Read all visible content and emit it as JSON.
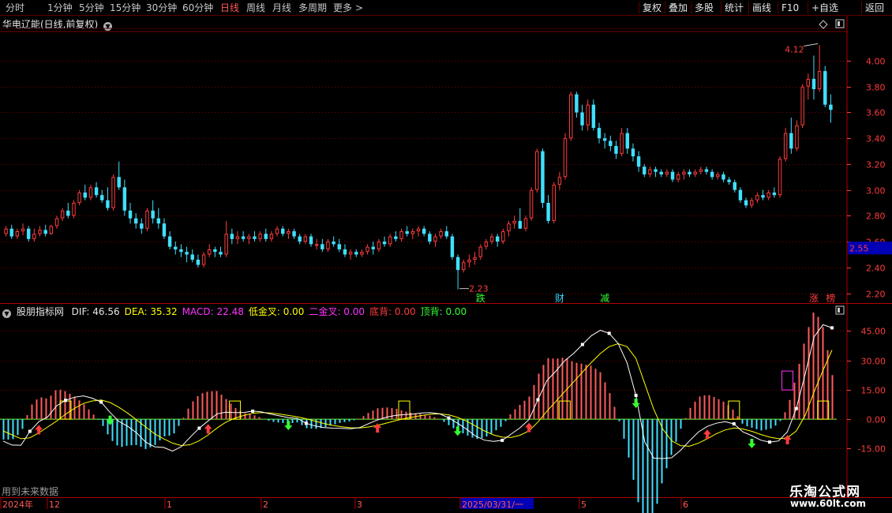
{
  "toolbar": {
    "periods": [
      "分时",
      "1分钟",
      "5分钟",
      "15分钟",
      "30分钟",
      "60分钟",
      "日线",
      "周线",
      "月线",
      "多周期",
      "更多"
    ],
    "active_period": "日线",
    "more_arrow": ">",
    "buttons": [
      "复权",
      "叠加",
      "多股",
      "统计",
      "画线",
      "F10",
      "+自选",
      "返回"
    ]
  },
  "main_chart": {
    "title": "华电辽能(日线,前复权)",
    "price_label": "2.55",
    "high_label": "4.12",
    "low_label": "2.23",
    "event_markers": [
      {
        "label": "跌",
        "color": "#33ff33"
      },
      {
        "label": "财",
        "color": "#33d6ff"
      },
      {
        "label": "减",
        "color": "#33ff33"
      },
      {
        "label": "涨",
        "color": "#ff3c3c"
      },
      {
        "label": "榜",
        "color": "#ff3c3c"
      }
    ]
  },
  "indicator": {
    "name": "股朋指标网",
    "items": [
      {
        "text": "DIF: 46.56",
        "color": "#e6e6e6"
      },
      {
        "text": "DEA: 35.32",
        "color": "#ffff00"
      },
      {
        "text": "MACD: 22.48",
        "color": "#ff33ff"
      },
      {
        "text": "低金叉: 0.00",
        "color": "#ffff00"
      },
      {
        "text": "二金叉: 0.00",
        "color": "#ff33ff"
      },
      {
        "text": "底背: 0.00",
        "color": "#ff3c3c"
      },
      {
        "text": "顶背: 0.00",
        "color": "#33ff33"
      }
    ]
  },
  "footer": {
    "note": "用到未来数据",
    "watermark_cn": "乐淘公式网",
    "watermark_url": "www.60lt.com",
    "date_labels": [
      "2024年",
      "12",
      "1",
      "2",
      "3",
      "2025/03/31/一",
      "5",
      "6"
    ]
  },
  "colors": {
    "up": "#ff3c3c",
    "down": "#40e0ff",
    "dif": "#ffffff",
    "dea": "#ffff00",
    "grid": "#7a0000",
    "axis": "#ff3c3c"
  },
  "chart_data": [
    {
      "type": "candlestick",
      "title": "华电辽能(日线,前复权)",
      "y_ticks": [
        2.2,
        2.4,
        2.6,
        2.8,
        3.0,
        3.2,
        3.4,
        3.6,
        3.8,
        4.0
      ],
      "ylim": [
        2.13,
        4.22
      ],
      "last_price": 2.55,
      "highest": 4.12,
      "lowest": 2.23,
      "grid": true,
      "candles": [
        [
          2.66,
          2.72,
          2.64,
          2.7
        ],
        [
          2.7,
          2.73,
          2.62,
          2.64
        ],
        [
          2.64,
          2.7,
          2.62,
          2.68
        ],
        [
          2.68,
          2.74,
          2.65,
          2.7
        ],
        [
          2.7,
          2.72,
          2.6,
          2.62
        ],
        [
          2.62,
          2.7,
          2.6,
          2.66
        ],
        [
          2.66,
          2.72,
          2.64,
          2.69
        ],
        [
          2.69,
          2.73,
          2.64,
          2.66
        ],
        [
          2.66,
          2.73,
          2.65,
          2.72
        ],
        [
          2.72,
          2.8,
          2.7,
          2.78
        ],
        [
          2.78,
          2.86,
          2.76,
          2.84
        ],
        [
          2.84,
          2.9,
          2.78,
          2.8
        ],
        [
          2.8,
          2.92,
          2.78,
          2.9
        ],
        [
          2.9,
          3.0,
          2.88,
          2.98
        ],
        [
          2.98,
          3.04,
          2.92,
          2.94
        ],
        [
          2.94,
          3.04,
          2.92,
          3.02
        ],
        [
          3.02,
          3.06,
          2.94,
          2.96
        ],
        [
          2.96,
          3.0,
          2.9,
          2.92
        ],
        [
          2.92,
          3.02,
          2.84,
          2.86
        ],
        [
          2.86,
          3.12,
          2.84,
          3.1
        ],
        [
          3.1,
          3.22,
          3.0,
          3.02
        ],
        [
          3.02,
          3.08,
          2.8,
          2.84
        ],
        [
          2.84,
          2.9,
          2.74,
          2.78
        ],
        [
          2.78,
          2.82,
          2.7,
          2.74
        ],
        [
          2.74,
          2.78,
          2.66,
          2.7
        ],
        [
          2.7,
          2.86,
          2.68,
          2.84
        ],
        [
          2.84,
          2.92,
          2.74,
          2.78
        ],
        [
          2.78,
          2.86,
          2.7,
          2.74
        ],
        [
          2.74,
          2.78,
          2.62,
          2.64
        ],
        [
          2.64,
          2.68,
          2.54,
          2.56
        ],
        [
          2.56,
          2.6,
          2.5,
          2.54
        ],
        [
          2.54,
          2.58,
          2.48,
          2.52
        ],
        [
          2.52,
          2.56,
          2.44,
          2.5
        ],
        [
          2.5,
          2.54,
          2.44,
          2.46
        ],
        [
          2.46,
          2.5,
          2.4,
          2.42
        ],
        [
          2.42,
          2.52,
          2.4,
          2.5
        ],
        [
          2.5,
          2.58,
          2.48,
          2.54
        ],
        [
          2.54,
          2.56,
          2.48,
          2.52
        ],
        [
          2.52,
          2.56,
          2.48,
          2.5
        ],
        [
          2.5,
          2.76,
          2.48,
          2.66
        ],
        [
          2.66,
          2.7,
          2.58,
          2.62
        ],
        [
          2.62,
          2.68,
          2.58,
          2.64
        ],
        [
          2.64,
          2.68,
          2.6,
          2.62
        ],
        [
          2.62,
          2.66,
          2.58,
          2.64
        ],
        [
          2.64,
          2.68,
          2.6,
          2.62
        ],
        [
          2.62,
          2.68,
          2.6,
          2.66
        ],
        [
          2.66,
          2.7,
          2.6,
          2.62
        ],
        [
          2.62,
          2.68,
          2.6,
          2.66
        ],
        [
          2.66,
          2.72,
          2.64,
          2.7
        ],
        [
          2.7,
          2.72,
          2.64,
          2.66
        ],
        [
          2.66,
          2.7,
          2.62,
          2.68
        ],
        [
          2.68,
          2.7,
          2.62,
          2.64
        ],
        [
          2.64,
          2.66,
          2.58,
          2.6
        ],
        [
          2.6,
          2.66,
          2.58,
          2.64
        ],
        [
          2.64,
          2.66,
          2.56,
          2.58
        ],
        [
          2.58,
          2.62,
          2.54,
          2.58
        ],
        [
          2.58,
          2.62,
          2.52,
          2.54
        ],
        [
          2.54,
          2.62,
          2.52,
          2.6
        ],
        [
          2.6,
          2.64,
          2.56,
          2.58
        ],
        [
          2.58,
          2.62,
          2.52,
          2.54
        ],
        [
          2.54,
          2.58,
          2.48,
          2.5
        ],
        [
          2.5,
          2.54,
          2.46,
          2.52
        ],
        [
          2.52,
          2.54,
          2.48,
          2.5
        ],
        [
          2.5,
          2.54,
          2.48,
          2.52
        ],
        [
          2.52,
          2.58,
          2.5,
          2.56
        ],
        [
          2.56,
          2.6,
          2.5,
          2.54
        ],
        [
          2.54,
          2.62,
          2.52,
          2.6
        ],
        [
          2.6,
          2.64,
          2.56,
          2.58
        ],
        [
          2.58,
          2.66,
          2.56,
          2.64
        ],
        [
          2.64,
          2.68,
          2.6,
          2.62
        ],
        [
          2.62,
          2.7,
          2.6,
          2.68
        ],
        [
          2.68,
          2.72,
          2.64,
          2.66
        ],
        [
          2.66,
          2.7,
          2.62,
          2.68
        ],
        [
          2.68,
          2.72,
          2.64,
          2.7
        ],
        [
          2.7,
          2.72,
          2.64,
          2.66
        ],
        [
          2.66,
          2.68,
          2.58,
          2.6
        ],
        [
          2.6,
          2.66,
          2.56,
          2.64
        ],
        [
          2.64,
          2.7,
          2.62,
          2.68
        ],
        [
          2.68,
          2.72,
          2.62,
          2.64
        ],
        [
          2.64,
          2.66,
          2.46,
          2.48
        ],
        [
          2.48,
          2.5,
          2.23,
          2.38
        ],
        [
          2.38,
          2.46,
          2.36,
          2.44
        ],
        [
          2.44,
          2.5,
          2.4,
          2.46
        ],
        [
          2.46,
          2.52,
          2.42,
          2.48
        ],
        [
          2.48,
          2.58,
          2.46,
          2.56
        ],
        [
          2.56,
          2.62,
          2.54,
          2.6
        ],
        [
          2.6,
          2.66,
          2.58,
          2.64
        ],
        [
          2.64,
          2.66,
          2.56,
          2.6
        ],
        [
          2.6,
          2.7,
          2.58,
          2.68
        ],
        [
          2.68,
          2.76,
          2.64,
          2.74
        ],
        [
          2.74,
          2.8,
          2.7,
          2.76
        ],
        [
          2.76,
          2.86,
          2.7,
          2.7
        ],
        [
          2.7,
          2.8,
          2.68,
          2.78
        ],
        [
          2.78,
          3.02,
          2.76,
          3.0
        ],
        [
          3.0,
          3.32,
          2.98,
          3.3
        ],
        [
          3.3,
          3.32,
          2.86,
          2.9
        ],
        [
          2.9,
          2.96,
          2.74,
          2.76
        ],
        [
          2.76,
          3.06,
          2.74,
          3.04
        ],
        [
          3.04,
          3.14,
          3.0,
          3.1
        ],
        [
          3.1,
          3.44,
          3.08,
          3.4
        ],
        [
          3.4,
          3.76,
          3.38,
          3.74
        ],
        [
          3.74,
          3.76,
          3.56,
          3.6
        ],
        [
          3.6,
          3.66,
          3.46,
          3.5
        ],
        [
          3.5,
          3.7,
          3.46,
          3.66
        ],
        [
          3.66,
          3.7,
          3.46,
          3.48
        ],
        [
          3.48,
          3.52,
          3.36,
          3.4
        ],
        [
          3.4,
          3.44,
          3.32,
          3.38
        ],
        [
          3.38,
          3.42,
          3.3,
          3.34
        ],
        [
          3.34,
          3.38,
          3.24,
          3.28
        ],
        [
          3.28,
          3.48,
          3.26,
          3.44
        ],
        [
          3.44,
          3.48,
          3.28,
          3.32
        ],
        [
          3.32,
          3.36,
          3.22,
          3.26
        ],
        [
          3.26,
          3.3,
          3.14,
          3.18
        ],
        [
          3.18,
          3.2,
          3.1,
          3.12
        ],
        [
          3.12,
          3.18,
          3.1,
          3.16
        ],
        [
          3.16,
          3.18,
          3.1,
          3.14
        ],
        [
          3.14,
          3.16,
          3.1,
          3.12
        ],
        [
          3.12,
          3.16,
          3.1,
          3.14
        ],
        [
          3.14,
          3.16,
          3.06,
          3.08
        ],
        [
          3.08,
          3.14,
          3.06,
          3.12
        ],
        [
          3.12,
          3.16,
          3.08,
          3.14
        ],
        [
          3.14,
          3.16,
          3.1,
          3.12
        ],
        [
          3.12,
          3.16,
          3.1,
          3.14
        ],
        [
          3.14,
          3.18,
          3.12,
          3.16
        ],
        [
          3.16,
          3.18,
          3.12,
          3.14
        ],
        [
          3.14,
          3.16,
          3.08,
          3.1
        ],
        [
          3.1,
          3.14,
          3.08,
          3.12
        ],
        [
          3.12,
          3.14,
          3.06,
          3.08
        ],
        [
          3.08,
          3.1,
          3.04,
          3.06
        ],
        [
          3.06,
          3.08,
          2.98,
          3.0
        ],
        [
          3.0,
          3.02,
          2.9,
          2.92
        ],
        [
          2.92,
          2.94,
          2.86,
          2.88
        ],
        [
          2.88,
          2.94,
          2.86,
          2.92
        ],
        [
          2.92,
          2.98,
          2.9,
          2.96
        ],
        [
          2.96,
          3.0,
          2.92,
          2.94
        ],
        [
          2.94,
          3.0,
          2.92,
          2.98
        ],
        [
          2.98,
          3.02,
          2.94,
          2.96
        ],
        [
          2.96,
          3.26,
          2.94,
          3.24
        ],
        [
          3.24,
          3.48,
          3.22,
          3.44
        ],
        [
          3.44,
          3.56,
          3.28,
          3.32
        ],
        [
          3.32,
          3.54,
          3.3,
          3.5
        ],
        [
          3.5,
          3.82,
          3.48,
          3.8
        ],
        [
          3.8,
          3.9,
          3.7,
          3.86
        ],
        [
          3.86,
          4.04,
          3.7,
          3.78
        ],
        [
          3.78,
          4.12,
          3.76,
          3.92
        ],
        [
          3.92,
          3.96,
          3.64,
          3.66
        ],
        [
          3.66,
          3.74,
          3.52,
          3.62
        ]
      ]
    },
    {
      "type": "line",
      "title": "股朋指标网",
      "y_ticks": [
        -15.0,
        0.0,
        15.0,
        30.0,
        45.0
      ],
      "ylim": [
        -35,
        52
      ],
      "grid": true,
      "series": [
        {
          "name": "DIF",
          "values": [
            -11.2,
            -13.2,
            -13.3,
            -6.2,
            -1.3,
            1.2,
            6.8,
            9.6,
            11.2,
            11.9,
            10.7,
            8.7,
            3.4,
            -1.2,
            -3.7,
            -7.1,
            -11.7,
            -14.1,
            -14.4,
            -16.3,
            -14.0,
            -9.1,
            -4.6,
            -0.9,
            2.7,
            3.6,
            3.4,
            3.4,
            4.1,
            3.7,
            2.6,
            1.7,
            0.8,
            0.4,
            -2.1,
            -3.5,
            -4.3,
            -4.6,
            -4.7,
            -4.9,
            -4.3,
            -2.3,
            -0.4,
            1.0,
            1.9,
            2.3,
            2.6,
            3.2,
            3.3,
            2.7,
            0.6,
            -2.1,
            -5.1,
            -8.6,
            -10.7,
            -11.3,
            -10.8,
            -7.6,
            -4.4,
            -0.2,
            9.9,
            19.6,
            24.4,
            29.8,
            33.5,
            38.1,
            42.6,
            45.4,
            43.8,
            38.7,
            28.8,
            12.1,
            -11.7,
            -19.9,
            -20.1,
            -19.7,
            -15.9,
            -11.1,
            -6.6,
            -3.7,
            -2.1,
            -1.3,
            -2.4,
            -6.5,
            -8.4,
            -10.7,
            -11.7,
            -11.1,
            -6.4,
            5.4,
            23.1,
            42.1,
            48.2,
            46.6
          ]
        },
        {
          "name": "DEA",
          "values": [
            -6.0,
            -8.0,
            -10.0,
            -9.5,
            -7.0,
            -4.0,
            -1.0,
            2.5,
            5.5,
            8.0,
            9.3,
            9.8,
            8.5,
            6.0,
            3.0,
            -0.5,
            -4.0,
            -7.5,
            -10.0,
            -12.2,
            -13.5,
            -13.0,
            -11.0,
            -8.0,
            -4.5,
            -1.5,
            0.5,
            1.9,
            3.0,
            3.4,
            3.2,
            2.6,
            1.9,
            1.2,
            0.2,
            -1.0,
            -2.2,
            -3.2,
            -3.9,
            -4.4,
            -4.5,
            -4.0,
            -3.2,
            -2.0,
            -0.8,
            0.3,
            1.1,
            1.9,
            2.5,
            2.7,
            2.2,
            0.9,
            -1.0,
            -3.5,
            -6.0,
            -8.0,
            -9.2,
            -9.3,
            -8.2,
            -6.0,
            -1.5,
            4.0,
            9.0,
            14.0,
            19.0,
            24.0,
            29.0,
            33.5,
            37.0,
            38.5,
            37.0,
            31.0,
            18.0,
            5.0,
            -5.0,
            -11.0,
            -13.5,
            -13.8,
            -12.3,
            -10.0,
            -7.5,
            -5.5,
            -4.5,
            -5.0,
            -6.2,
            -7.8,
            -9.2,
            -10.0,
            -9.5,
            -6.0,
            2.0,
            14.0,
            25.0,
            35.3
          ]
        },
        {
          "name": "MACD",
          "values": [
            -10.4,
            -10.4,
            -6.6,
            6.6,
            11.4,
            10.4,
            15.6,
            14.2,
            11.4,
            7.8,
            2.8,
            -2.2,
            -10.2,
            -14.4,
            -13.4,
            -13.2,
            -15.4,
            -13.2,
            -8.8,
            -8.2,
            -1.0,
            7.8,
            12.8,
            14.2,
            14.4,
            10.2,
            5.8,
            3.0,
            2.2,
            0.6,
            -1.2,
            -1.8,
            -2.2,
            -1.6,
            -4.6,
            -5.0,
            -4.2,
            -2.8,
            -1.6,
            -1.0,
            0.4,
            3.4,
            5.6,
            6.0,
            5.4,
            4.0,
            3.0,
            2.6,
            1.6,
            0.0,
            -3.2,
            -6.0,
            -8.2,
            -10.2,
            -9.4,
            -6.6,
            -3.2,
            3.4,
            7.6,
            11.6,
            22.8,
            31.2,
            30.8,
            31.6,
            29.0,
            28.2,
            27.2,
            23.8,
            13.6,
            0.4,
            -16.4,
            -37.8,
            -59.4,
            -49.8,
            -30.2,
            -17.4,
            -4.8,
            5.4,
            11.4,
            12.6,
            10.8,
            8.4,
            4.2,
            -3.0,
            -4.4,
            -5.8,
            -5.0,
            -2.2,
            6.2,
            22.8,
            42.2,
            56.2,
            46.4,
            22.5
          ]
        }
      ]
    }
  ]
}
